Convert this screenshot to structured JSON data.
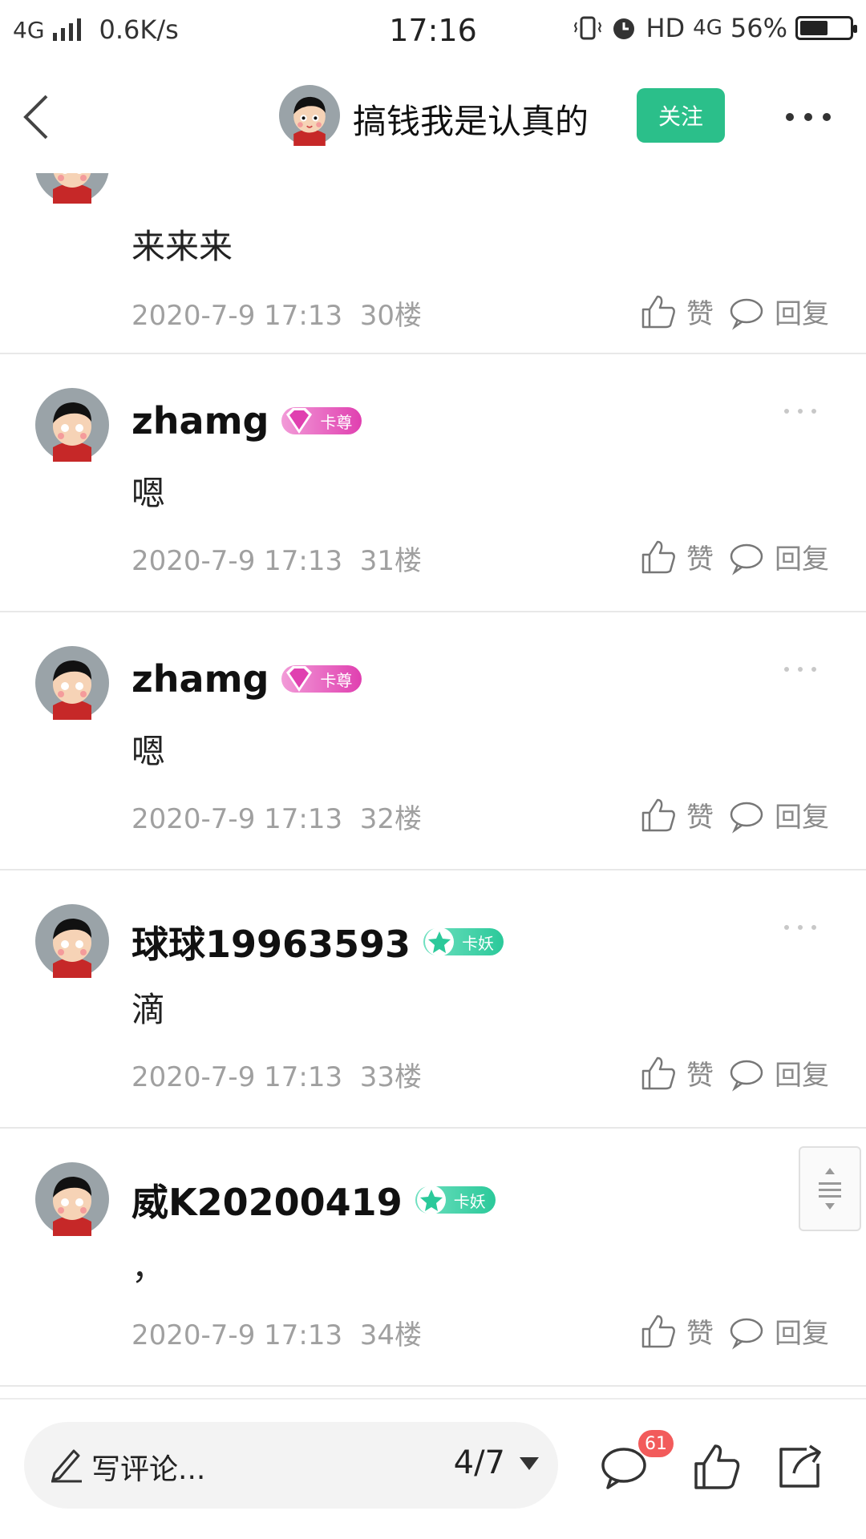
{
  "status_bar": {
    "network": "4G",
    "speed": "0.6K/s",
    "time": "17:16",
    "hd": "HD",
    "network_right": "4G",
    "battery": "56%",
    "battery_level": 0.56
  },
  "header": {
    "title": "搞钱我是认真的",
    "follow_label": "关注"
  },
  "comments": [
    {
      "username": "",
      "badge": "",
      "badge_style": "",
      "content": "来来来",
      "time": "2020-7-9 17:13",
      "floor": "30楼",
      "like_label": "赞",
      "reply_label": "回复"
    },
    {
      "username": "zhamg",
      "badge": "卡尊",
      "badge_style": "pink",
      "content": "嗯",
      "time": "2020-7-9 17:13",
      "floor": "31楼",
      "like_label": "赞",
      "reply_label": "回复"
    },
    {
      "username": "zhamg",
      "badge": "卡尊",
      "badge_style": "pink",
      "content": "嗯",
      "time": "2020-7-9 17:13",
      "floor": "32楼",
      "like_label": "赞",
      "reply_label": "回复"
    },
    {
      "username": "球球19963593",
      "badge": "卡妖",
      "badge_style": "green",
      "content": "滴",
      "time": "2020-7-9 17:13",
      "floor": "33楼",
      "like_label": "赞",
      "reply_label": "回复"
    },
    {
      "username": "威K20200419",
      "badge": "卡妖",
      "badge_style": "green",
      "content": "，",
      "time": "2020-7-9 17:13",
      "floor": "34楼",
      "like_label": "赞",
      "reply_label": "回复"
    }
  ],
  "bottom_bar": {
    "placeholder": "写评论...",
    "page": "4/7",
    "comment_count": "61"
  },
  "colors": {
    "accent": "#2bbf8a",
    "badge_pink": "#e040b0",
    "badge_green": "#2bc99a",
    "count_red": "#f25b5b"
  }
}
